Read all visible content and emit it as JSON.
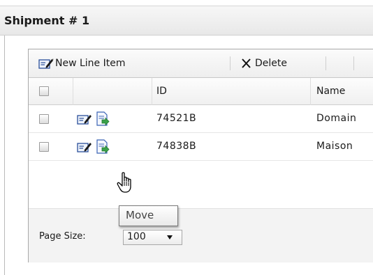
{
  "shipment": {
    "title": "Shipment # 1"
  },
  "toolbar": {
    "new_line_item_label": "New Line Item",
    "delete_label": "Delete",
    "new_icon": "edit-pencil-icon",
    "delete_icon": "x-icon"
  },
  "columns": {
    "id": "ID",
    "name": "Name"
  },
  "rows": [
    {
      "id": "74521B",
      "name": "Domain"
    },
    {
      "id": "74838B",
      "name": "Maison"
    }
  ],
  "pager": {
    "page_size_label": "Page Size:",
    "page_size_value": "100"
  },
  "tooltip": {
    "text": "Move"
  }
}
